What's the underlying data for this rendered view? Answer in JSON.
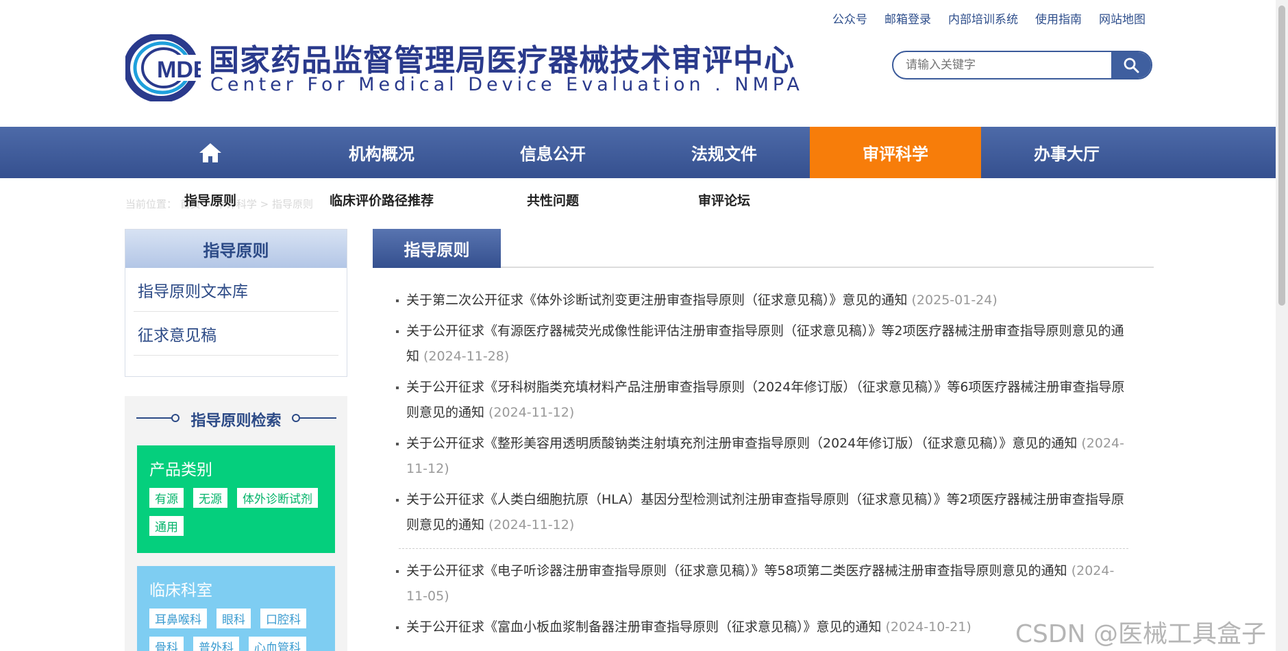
{
  "top_links": [
    "公众号",
    "邮箱登录",
    "内部培训系统",
    "使用指南",
    "网站地图"
  ],
  "logo": {
    "mark_text": "MDE",
    "cn_name": "国家药品监督管理局医疗器械技术审评中心",
    "en_name": "Center For Medical Device Evaluation . NMPA"
  },
  "search": {
    "placeholder": "请输入关键字"
  },
  "nav": {
    "items": [
      "机构概况",
      "信息公开",
      "法规文件",
      "审评科学",
      "办事大厅"
    ],
    "active": "审评科学"
  },
  "subnav": [
    "指导原则",
    "临床评价路径推荐",
    "共性问题",
    "审评论坛"
  ],
  "breadcrumb_hidden": "当前位置： 首页 > 审评科学 > 指导原则",
  "sidebar": {
    "title": "指导原则",
    "links": [
      "指导原则文本库",
      "征求意见稿"
    ],
    "search_title": "指导原则检索",
    "product": {
      "title": "产品类别",
      "tags": [
        "有源",
        "无源",
        "体外诊断试剂",
        "通用"
      ]
    },
    "clinical": {
      "title": "临床科室",
      "tags": [
        "耳鼻喉科",
        "眼科",
        "口腔科",
        "骨科",
        "普外科",
        "心血管科"
      ]
    }
  },
  "main": {
    "tab": "指导原则",
    "news": [
      {
        "title": "关于第二次公开征求《体外诊断试剂变更注册审查指导原则（征求意见稿）》意见的通知",
        "date": "(2025-01-24)"
      },
      {
        "title": "关于公开征求《有源医疗器械荧光成像性能评估注册审查指导原则（征求意见稿）》等2项医疗器械注册审查指导原则意见的通知",
        "date": "(2024-11-28)"
      },
      {
        "title": "关于公开征求《牙科树脂类充填材料产品注册审查指导原则（2024年修订版）（征求意见稿）》等6项医疗器械注册审查指导原则意见的通知",
        "date": "(2024-11-12)"
      },
      {
        "title": "关于公开征求《整形美容用透明质酸钠类注射填充剂注册审查指导原则（2024年修订版）（征求意见稿）》意见的通知",
        "date": "(2024-11-12)"
      },
      {
        "title": "关于公开征求《人类白细胞抗原（HLA）基因分型检测试剂注册审查指导原则（征求意见稿）》等2项医疗器械注册审查指导原则意见的通知",
        "date": "(2024-11-12)"
      },
      {
        "title": "关于公开征求《电子听诊器注册审查指导原则（征求意见稿）》等58项第二类医疗器械注册审查指导原则意见的通知",
        "date": "(2024-11-05)"
      },
      {
        "title": "关于公开征求《富血小板血浆制备器注册审查指导原则（征求意见稿）》意见的通知",
        "date": "(2024-10-21)"
      }
    ]
  },
  "watermark": "CSDN @医械工具盒子",
  "colors": {
    "nav_blue": "#3f5f9f",
    "active_orange": "#f77d0a",
    "green": "#05cf7d",
    "light_blue": "#7ecdf2"
  }
}
